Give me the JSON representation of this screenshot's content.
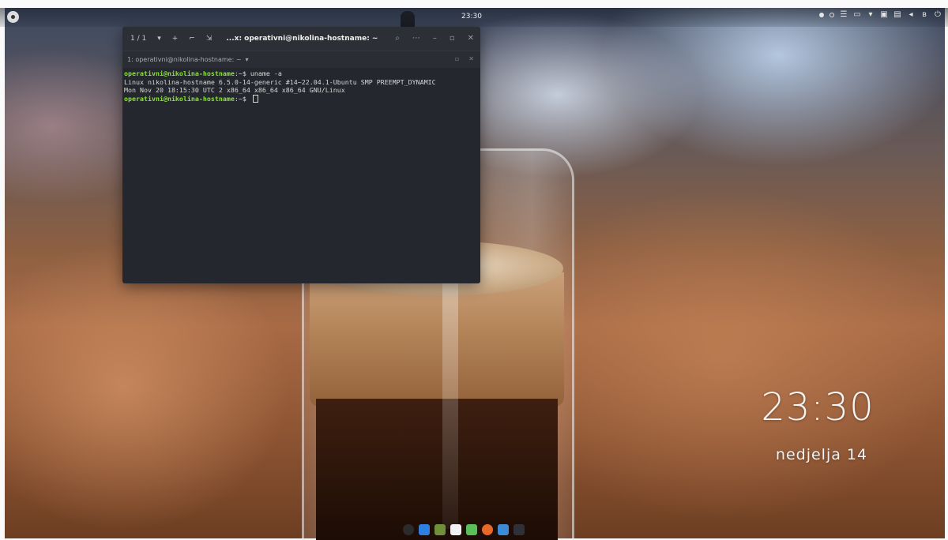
{
  "topbar": {
    "clock": "23:30",
    "tray_icons": [
      "workspace-indicator-icon",
      "menu-icon",
      "clipboard-icon",
      "wifi-icon",
      "network-icon",
      "battery-icon",
      "volume-icon",
      "bluetooth-icon",
      "power-icon"
    ]
  },
  "terminal": {
    "titlebar": {
      "tab_counter": "1 / 1",
      "title": "...x: operativni@nikolina-hostname: ~"
    },
    "tab": {
      "label": "1: operativni@nikolina-hostname: ~"
    },
    "lines": [
      {
        "user": "operativni@nikolina-hostname",
        "path": ":~$ ",
        "text": "uname -a"
      },
      {
        "text": "Linux nikolina-hostname 6.5.0-14-generic #14~22.04.1-Ubuntu SMP PREEMPT_DYNAMIC"
      },
      {
        "text": "Mon Nov 20 18:15:30 UTC 2 x86_64 x86_64 x86_64 GNU/Linux"
      },
      {
        "user": "operativni@nikolina-hostname",
        "path": ":~$ ",
        "text": ""
      }
    ]
  },
  "desktop_clock": {
    "time": "23:30",
    "date": "nedjelja 14"
  },
  "dock": {
    "apps": [
      {
        "name": "show-apps-icon",
        "color": "#2b2b2b"
      },
      {
        "name": "mail-icon",
        "color": "#2f7fe0"
      },
      {
        "name": "settings-icon",
        "color": "#6f8f3a"
      },
      {
        "name": "document-viewer-icon",
        "color": "#f2f2f2"
      },
      {
        "name": "text-editor-icon",
        "color": "#5bbf57"
      },
      {
        "name": "firefox-icon",
        "color": "#e8682a"
      },
      {
        "name": "files-icon",
        "color": "#3d8bd6"
      },
      {
        "name": "terminal-icon",
        "color": "#2f3138"
      }
    ]
  }
}
